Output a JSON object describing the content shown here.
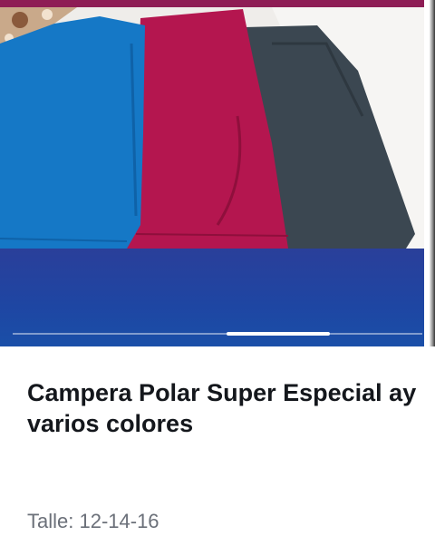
{
  "product": {
    "image_name": "polar-jackets-photo",
    "title": "Campera Polar Super Especial ay varios colores",
    "size_label": "Talle: 12-14-16"
  },
  "carousel": {
    "active_slide_index": 2,
    "slide_count": 4
  },
  "colors": {
    "band": "#1e46a3",
    "top_strip": "#8e1d55",
    "fleece_blue": "#1379c8",
    "fleece_magenta": "#b3154e",
    "fleece_charcoal": "#3a4650",
    "title_text": "#14171c",
    "muted_text": "#6b7079"
  }
}
